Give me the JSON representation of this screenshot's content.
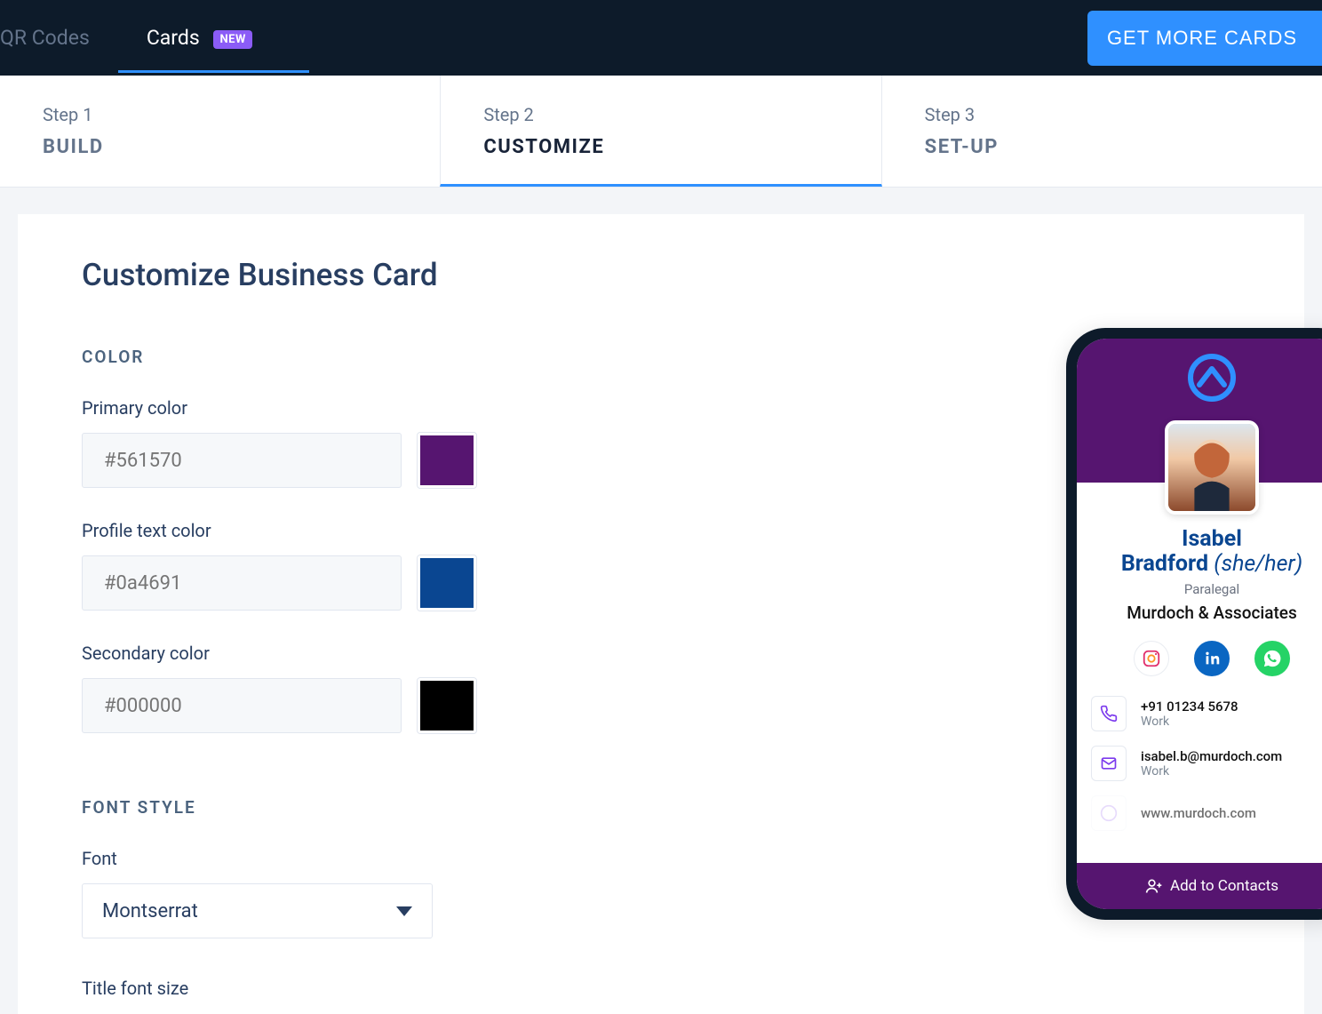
{
  "nav": {
    "tab_qr": "QR Codes",
    "tab_cards": "Cards",
    "badge_new": "NEW",
    "cta": "GET MORE CARDS"
  },
  "steps": [
    {
      "num": "Step 1",
      "name": "BUILD"
    },
    {
      "num": "Step 2",
      "name": "CUSTOMIZE"
    },
    {
      "num": "Step 3",
      "name": "SET-UP"
    }
  ],
  "page": {
    "title": "Customize Business Card"
  },
  "sections": {
    "color_label": "COLOR",
    "font_label": "FONT STYLE"
  },
  "fields": {
    "primary_label": "Primary color",
    "primary_value": "#561570",
    "profile_label": "Profile text color",
    "profile_value": "#0a4691",
    "secondary_label": "Secondary color",
    "secondary_value": "#000000",
    "font_label": "Font",
    "font_value": "Montserrat",
    "title_font_size_label": "Title font size"
  },
  "colors": {
    "primary": "#561570",
    "profile_text": "#0a4691",
    "secondary": "#000000"
  },
  "preview": {
    "name_first": "Isabel",
    "name_last": "Bradford",
    "pronoun": "(she/her)",
    "role": "Paralegal",
    "company": "Murdoch & Associates",
    "phone": "+91 01234 5678",
    "phone_label": "Work",
    "email": "isabel.b@murdoch.com",
    "email_label": "Work",
    "web": "www.murdoch.com",
    "footer": "Add to Contacts"
  }
}
